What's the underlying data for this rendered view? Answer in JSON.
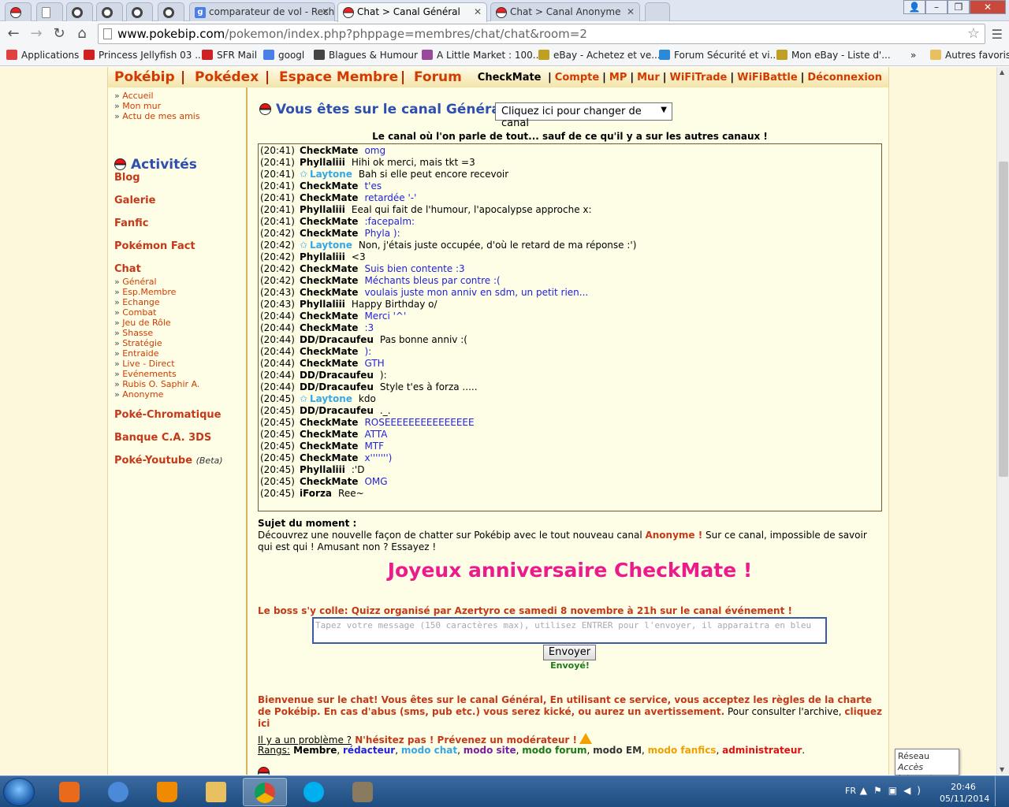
{
  "browser": {
    "tabs": [
      {
        "label": "",
        "icon": "poke"
      },
      {
        "label": "",
        "icon": "page"
      },
      {
        "label": "",
        "icon": "ring"
      },
      {
        "label": "",
        "icon": "ring"
      },
      {
        "label": "",
        "icon": "ring"
      },
      {
        "label": "",
        "icon": "ring"
      },
      {
        "label": "comparateur de vol - Rech",
        "icon": "g"
      },
      {
        "label": "Chat > Canal Général",
        "icon": "poke",
        "active": true
      },
      {
        "label": "Chat > Canal Anonyme",
        "icon": "poke"
      }
    ],
    "url_host": "www.pokebip.com",
    "url_path": "/pokemon/index.php?phppage=membres/chat/chat&room=2",
    "bookmarks": [
      "Applications",
      "Princess Jellyfish 03 ...",
      "SFR Mail",
      "googl",
      "Blagues & Humour",
      "A Little Market : 100...",
      "eBay - Achetez et ve...",
      "Forum Sécurité et vi...",
      "Mon eBay - Liste d'...",
      "»",
      "Autres favoris"
    ]
  },
  "nav": {
    "main": [
      "Pokébip",
      "Pokédex",
      "Espace Membre",
      "Forum"
    ],
    "username": "CheckMate",
    "user_links": [
      "Compte",
      "MP",
      "Mur",
      "WiFiTrade",
      "WiFiBattle",
      "Déconnexion"
    ]
  },
  "sidebar": {
    "top_links": [
      "Accueil",
      "Mon mur",
      "Actu de mes amis"
    ],
    "activites": "Activités",
    "sections": [
      "Blog",
      "Galerie",
      "Fanfic",
      "Pokémon Fact"
    ],
    "chat_head": "Chat",
    "chat_links": [
      "Général",
      "Esp.Membre",
      "Echange",
      "Combat",
      "Jeu de Rôle",
      "Shasse",
      "Stratégie",
      "Entraide",
      "Live - Direct",
      "Evénements",
      "Rubis O. Saphir A.",
      "Anonyme"
    ],
    "bottom_sections": [
      "Poké-Chromatique",
      "Banque C.A. 3DS"
    ],
    "youtube": "Poké-Youtube",
    "youtube_beta": "(Beta)"
  },
  "chat": {
    "title": "Vous êtes sur le canal Général",
    "select_label": "Cliquez ici pour changer de canal",
    "description": "Le canal où l'on parle de tout... sauf de ce qu'il y a sur les autres canaux !",
    "messages": [
      {
        "time": "(20:41)",
        "user": "CheckMate",
        "text": "omg",
        "blue": true
      },
      {
        "time": "(20:41)",
        "user": "Phyllaliii",
        "text": "Hihi ok merci, mais tkt =3"
      },
      {
        "time": "(20:41)",
        "user": "Laytone",
        "text": "Bah si elle peut encore recevoir",
        "star": true
      },
      {
        "time": "(20:41)",
        "user": "CheckMate",
        "text": "t'es",
        "blue": true
      },
      {
        "time": "(20:41)",
        "user": "CheckMate",
        "text": "retardée '-'",
        "blue": true
      },
      {
        "time": "(20:41)",
        "user": "Phyllaliii",
        "text": "Eeal qui fait de l'humour, l'apocalypse approche x:"
      },
      {
        "time": "(20:41)",
        "user": "CheckMate",
        "text": ":facepalm:",
        "blue": true
      },
      {
        "time": "(20:42)",
        "user": "CheckMate",
        "text": "Phyla ):",
        "blue": true
      },
      {
        "time": "(20:42)",
        "user": "Laytone",
        "text": "Non, j'étais juste occupée, d'où le retard de ma réponse :')",
        "star": true
      },
      {
        "time": "(20:42)",
        "user": "Phyllaliii",
        "text": "<3"
      },
      {
        "time": "(20:42)",
        "user": "CheckMate",
        "text": "Suis bien contente :3",
        "blue": true
      },
      {
        "time": "(20:42)",
        "user": "CheckMate",
        "text": "Méchants bleus par contre :(",
        "blue": true
      },
      {
        "time": "(20:43)",
        "user": "CheckMate",
        "text": "voulais juste mon anniv en sdm, un petit rien...",
        "blue": true
      },
      {
        "time": "(20:43)",
        "user": "Phyllaliii",
        "text": "Happy Birthday o/"
      },
      {
        "time": "(20:44)",
        "user": "CheckMate",
        "text": "Merci '^'",
        "blue": true
      },
      {
        "time": "(20:44)",
        "user": "CheckMate",
        "text": ":3",
        "blue": true
      },
      {
        "time": "(20:44)",
        "user": "DD/Dracaufeu",
        "text": "Pas bonne anniv :("
      },
      {
        "time": "(20:44)",
        "user": "CheckMate",
        "text": "):",
        "blue": true
      },
      {
        "time": "(20:44)",
        "user": "CheckMate",
        "text": "GTH",
        "blue": true
      },
      {
        "time": "(20:44)",
        "user": "DD/Dracaufeu",
        "text": "):"
      },
      {
        "time": "(20:44)",
        "user": "DD/Dracaufeu",
        "text": "Style t'es à forza ....."
      },
      {
        "time": "(20:45)",
        "user": "Laytone",
        "text": "kdo",
        "star": true
      },
      {
        "time": "(20:45)",
        "user": "DD/Dracaufeu",
        "text": "._."
      },
      {
        "time": "(20:45)",
        "user": "CheckMate",
        "text": "ROSEEEEEEEEEEEEEEE",
        "blue": true
      },
      {
        "time": "(20:45)",
        "user": "CheckMate",
        "text": "ATTA",
        "blue": true
      },
      {
        "time": "(20:45)",
        "user": "CheckMate",
        "text": "MTF",
        "blue": true
      },
      {
        "time": "(20:45)",
        "user": "CheckMate",
        "text": "x''''''')",
        "blue": true
      },
      {
        "time": "(20:45)",
        "user": "Phyllaliii",
        "text": ":'D"
      },
      {
        "time": "(20:45)",
        "user": "CheckMate",
        "text": "OMG",
        "blue": true
      },
      {
        "time": "(20:45)",
        "user": "iForza",
        "text": "Ree~"
      }
    ],
    "sujet_label": "Sujet du moment :",
    "sujet_pre": "Découvrez une nouvelle façon de chatter sur Pokébip avec le tout nouveau canal ",
    "sujet_hl": "Anonyme !",
    "sujet_post": " Sur ce canal, impossible de savoir qui est qui ! Amusant non ? Essayez !",
    "birthday": "Joyeux anniversaire CheckMate !",
    "boss": "Le boss s'y colle: Quizz organisé par Azertyro ce samedi 8 novembre à 21h sur le canal événement !",
    "input_placeholder": "Tapez votre message (150 caractères max), utilisez ENTRER pour l'envoyer, il apparaitra en bleu",
    "send_label": "Envoyer",
    "sent_label": "Envoyé!",
    "welcome_red": "Bienvenue sur le chat! Vous êtes sur le canal Général, En utilisant ce service, vous acceptez les règles de la charte de Pokébip. En cas d'abus (sms, pub etc.) vous serez kické, ou aurez un avertissement.",
    "welcome_black": " Pour consulter l'archive, ",
    "welcome_link": "cliquez ici",
    "help_u": "Il y a un problème ?",
    "help_red": " N'hésitez pas ! Prévenez un modérateur !",
    "ranks_label": "Rangs:",
    "ranks": [
      {
        "name": "Membre",
        "color": "#000000"
      },
      {
        "name": "rédacteur",
        "color": "#2222dd"
      },
      {
        "name": "modo chat",
        "color": "#36a7e6"
      },
      {
        "name": "modo site",
        "color": "#7a1fa0"
      },
      {
        "name": "modo forum",
        "color": "#1a7a1a"
      },
      {
        "name": "modo EM",
        "color": "#333333"
      },
      {
        "name": "modo fanfics",
        "color": "#f0a000"
      },
      {
        "name": "administrateur",
        "color": "#dd1111"
      }
    ]
  },
  "tooltip": {
    "title": "Réseau",
    "sub": "Accès Internet"
  },
  "taskbar": {
    "lang": "FR",
    "time": "20:46",
    "date": "05/11/2014"
  }
}
